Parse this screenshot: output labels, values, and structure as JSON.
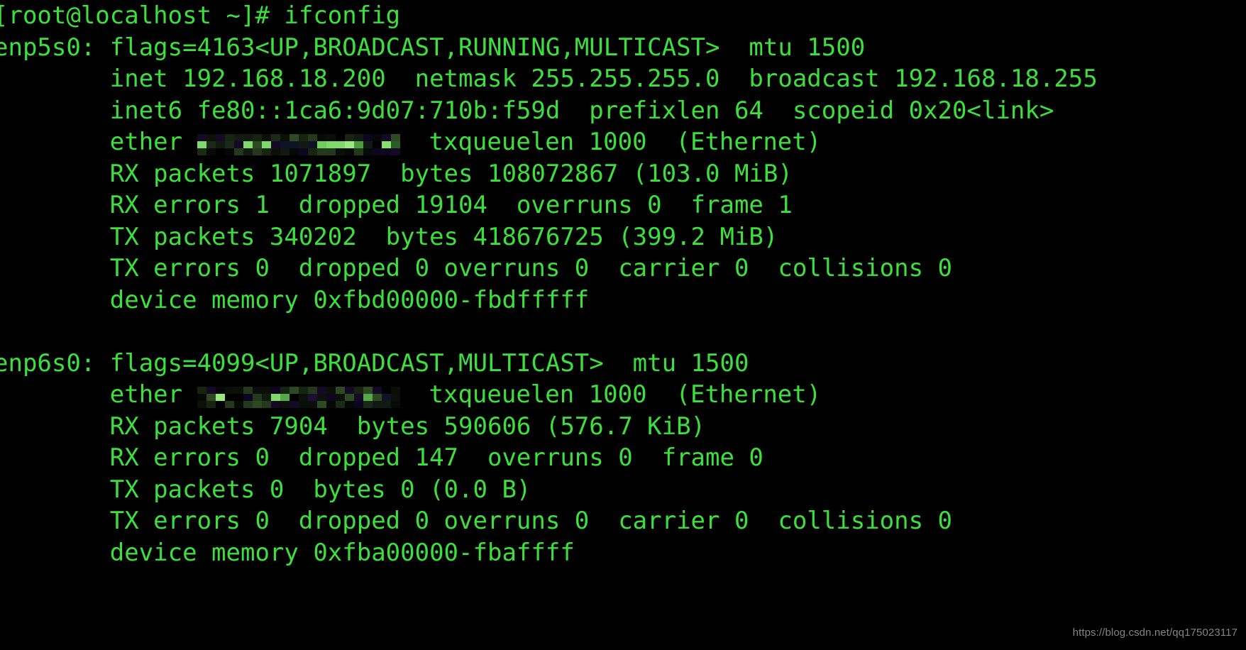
{
  "terminal": {
    "background_color": "#000000",
    "text_color": "#3ce03c",
    "prompt_line": "[root@localhost ~]# ifconfig",
    "lines": [
      {
        "id": "prompt",
        "text": "[root@localhost ~]# ifconfig",
        "indent": 0,
        "type": "prompt"
      },
      {
        "id": "enp5s0-flags",
        "text": "enp5s0: flags=4163<UP,BROADCAST,RUNNING,MULTICAST>  mtu 1500",
        "indent": 0,
        "type": "output"
      },
      {
        "id": "enp5s0-inet",
        "text": "        inet 192.168.18.200  netmask 255.255.255.0  broadcast 192.168.18.255",
        "indent": 8,
        "type": "output"
      },
      {
        "id": "enp5s0-inet6",
        "text": "        inet6 fe80::1ca6:9d07:710b:f59d  prefixlen 64  scopeid 0x20<link>",
        "indent": 8,
        "type": "output"
      },
      {
        "id": "enp5s0-ether",
        "text": "",
        "indent": 8,
        "type": "ether-redacted",
        "prefix": "        ether ",
        "suffix": "  txqueuelen 1000  (Ethernet)",
        "redaction_width": 286
      },
      {
        "id": "enp5s0-rx-packets",
        "text": "        RX packets 1071897  bytes 108072867 (103.0 MiB)",
        "indent": 8,
        "type": "output"
      },
      {
        "id": "enp5s0-rx-errors",
        "text": "        RX errors 1  dropped 19104  overruns 0  frame 1",
        "indent": 8,
        "type": "output"
      },
      {
        "id": "enp5s0-tx-packets",
        "text": "        TX packets 340202  bytes 418676725 (399.2 MiB)",
        "indent": 8,
        "type": "output"
      },
      {
        "id": "enp5s0-tx-errors",
        "text": "        TX errors 0  dropped 0 overruns 0  carrier 0  collisions 0",
        "indent": 8,
        "type": "output"
      },
      {
        "id": "enp5s0-device-memory",
        "text": "        device memory 0xfbd00000-fbdfffff",
        "indent": 8,
        "type": "output"
      },
      {
        "id": "blank-1",
        "text": "",
        "indent": 0,
        "type": "blank"
      },
      {
        "id": "enp6s0-flags",
        "text": "enp6s0: flags=4099<UP,BROADCAST,MULTICAST>  mtu 1500",
        "indent": 0,
        "type": "output"
      },
      {
        "id": "enp6s0-ether",
        "text": "",
        "indent": 8,
        "type": "ether-redacted",
        "prefix": "        ether ",
        "suffix": "  txqueuelen 1000  (Ethernet)",
        "redaction_width": 286
      },
      {
        "id": "enp6s0-rx-packets",
        "text": "        RX packets 7904  bytes 590606 (576.7 KiB)",
        "indent": 8,
        "type": "output"
      },
      {
        "id": "enp6s0-rx-errors",
        "text": "        RX errors 0  dropped 147  overruns 0  frame 0",
        "indent": 8,
        "type": "output"
      },
      {
        "id": "enp6s0-tx-packets",
        "text": "        TX packets 0  bytes 0 (0.0 B)",
        "indent": 8,
        "type": "output"
      },
      {
        "id": "enp6s0-tx-errors",
        "text": "        TX errors 0  dropped 0 overruns 0  carrier 0  collisions 0",
        "indent": 8,
        "type": "output"
      },
      {
        "id": "enp6s0-device-memory",
        "text": "        device memory 0xfba00000-fbaffff",
        "indent": 8,
        "type": "output"
      }
    ],
    "interfaces": [
      {
        "name": "enp5s0",
        "flags": "4163<UP,BROADCAST,RUNNING,MULTICAST>",
        "mtu": "1500",
        "inet": "192.168.18.200",
        "netmask": "255.255.255.0",
        "broadcast": "192.168.18.255",
        "inet6": "fe80::1ca6:9d07:710b:f59d",
        "prefixlen": "64",
        "scopeid": "0x20<link>",
        "ether": "[redacted]",
        "txqueuelen": "1000",
        "media": "(Ethernet)",
        "rx_packets": "1071897",
        "rx_bytes": "108072867",
        "rx_bytes_human": "103.0 MiB",
        "rx_errors": "1",
        "rx_dropped": "19104",
        "rx_overruns": "0",
        "rx_frame": "1",
        "tx_packets": "340202",
        "tx_bytes": "418676725",
        "tx_bytes_human": "399.2 MiB",
        "tx_errors": "0",
        "tx_dropped": "0",
        "tx_overruns": "0",
        "tx_carrier": "0",
        "tx_collisions": "0",
        "device_memory": "0xfbd00000-fbdfffff"
      },
      {
        "name": "enp6s0",
        "flags": "4099<UP,BROADCAST,MULTICAST>",
        "mtu": "1500",
        "ether": "[redacted]",
        "txqueuelen": "1000",
        "media": "(Ethernet)",
        "rx_packets": "7904",
        "rx_bytes": "590606",
        "rx_bytes_human": "576.7 KiB",
        "rx_errors": "0",
        "rx_dropped": "147",
        "rx_overruns": "0",
        "rx_frame": "0",
        "tx_packets": "0",
        "tx_bytes": "0",
        "tx_bytes_human": "0.0 B",
        "tx_errors": "0",
        "tx_dropped": "0",
        "tx_overruns": "0",
        "tx_carrier": "0",
        "tx_collisions": "0",
        "device_memory": "0xfba00000-fbaffff"
      }
    ]
  },
  "watermark": {
    "text": "https://blog.csdn.net/qq175023117",
    "color": "#8f8f8f"
  }
}
